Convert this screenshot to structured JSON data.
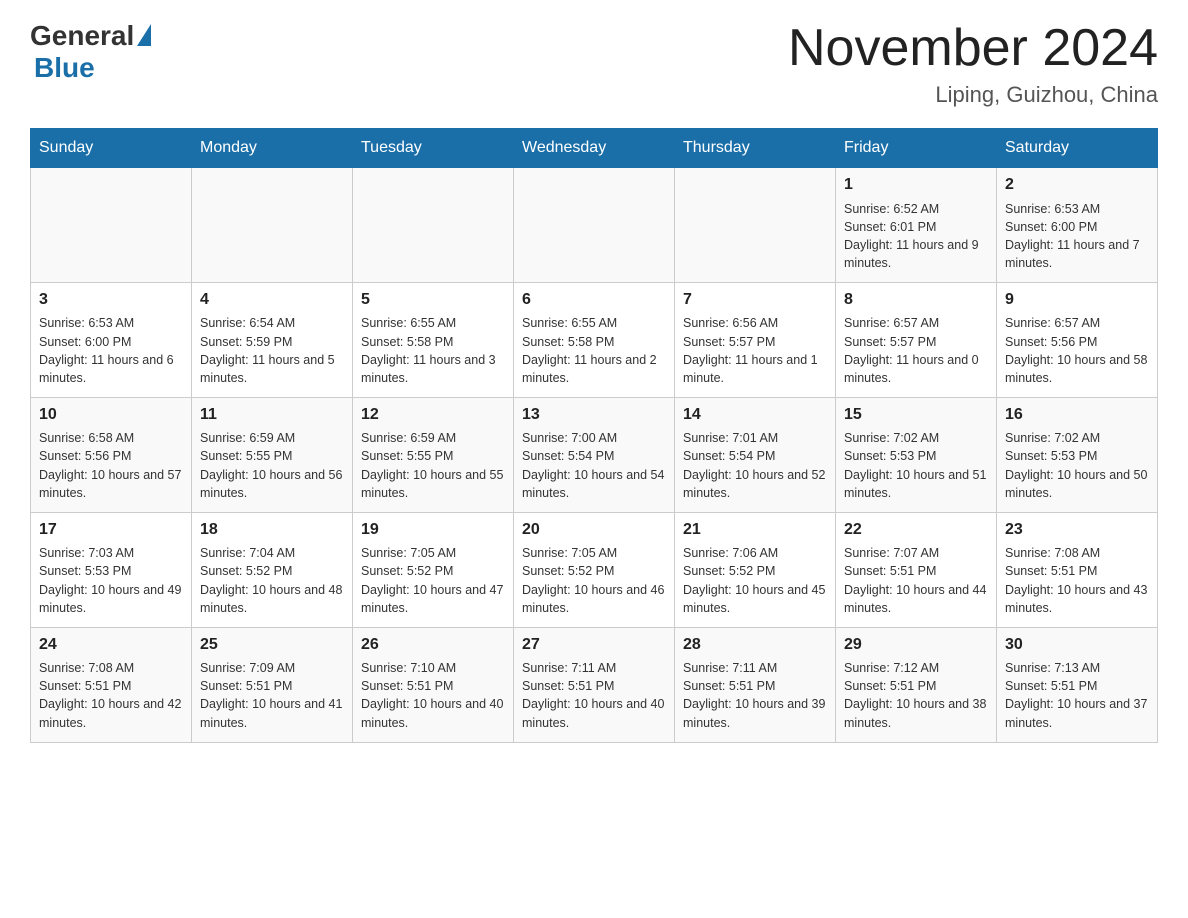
{
  "header": {
    "logo_general": "General",
    "logo_blue": "Blue",
    "month_title": "November 2024",
    "location": "Liping, Guizhou, China"
  },
  "days_of_week": [
    "Sunday",
    "Monday",
    "Tuesday",
    "Wednesday",
    "Thursday",
    "Friday",
    "Saturday"
  ],
  "weeks": [
    {
      "days": [
        {
          "num": "",
          "info": ""
        },
        {
          "num": "",
          "info": ""
        },
        {
          "num": "",
          "info": ""
        },
        {
          "num": "",
          "info": ""
        },
        {
          "num": "",
          "info": ""
        },
        {
          "num": "1",
          "info": "Sunrise: 6:52 AM\nSunset: 6:01 PM\nDaylight: 11 hours and 9 minutes."
        },
        {
          "num": "2",
          "info": "Sunrise: 6:53 AM\nSunset: 6:00 PM\nDaylight: 11 hours and 7 minutes."
        }
      ]
    },
    {
      "days": [
        {
          "num": "3",
          "info": "Sunrise: 6:53 AM\nSunset: 6:00 PM\nDaylight: 11 hours and 6 minutes."
        },
        {
          "num": "4",
          "info": "Sunrise: 6:54 AM\nSunset: 5:59 PM\nDaylight: 11 hours and 5 minutes."
        },
        {
          "num": "5",
          "info": "Sunrise: 6:55 AM\nSunset: 5:58 PM\nDaylight: 11 hours and 3 minutes."
        },
        {
          "num": "6",
          "info": "Sunrise: 6:55 AM\nSunset: 5:58 PM\nDaylight: 11 hours and 2 minutes."
        },
        {
          "num": "7",
          "info": "Sunrise: 6:56 AM\nSunset: 5:57 PM\nDaylight: 11 hours and 1 minute."
        },
        {
          "num": "8",
          "info": "Sunrise: 6:57 AM\nSunset: 5:57 PM\nDaylight: 11 hours and 0 minutes."
        },
        {
          "num": "9",
          "info": "Sunrise: 6:57 AM\nSunset: 5:56 PM\nDaylight: 10 hours and 58 minutes."
        }
      ]
    },
    {
      "days": [
        {
          "num": "10",
          "info": "Sunrise: 6:58 AM\nSunset: 5:56 PM\nDaylight: 10 hours and 57 minutes."
        },
        {
          "num": "11",
          "info": "Sunrise: 6:59 AM\nSunset: 5:55 PM\nDaylight: 10 hours and 56 minutes."
        },
        {
          "num": "12",
          "info": "Sunrise: 6:59 AM\nSunset: 5:55 PM\nDaylight: 10 hours and 55 minutes."
        },
        {
          "num": "13",
          "info": "Sunrise: 7:00 AM\nSunset: 5:54 PM\nDaylight: 10 hours and 54 minutes."
        },
        {
          "num": "14",
          "info": "Sunrise: 7:01 AM\nSunset: 5:54 PM\nDaylight: 10 hours and 52 minutes."
        },
        {
          "num": "15",
          "info": "Sunrise: 7:02 AM\nSunset: 5:53 PM\nDaylight: 10 hours and 51 minutes."
        },
        {
          "num": "16",
          "info": "Sunrise: 7:02 AM\nSunset: 5:53 PM\nDaylight: 10 hours and 50 minutes."
        }
      ]
    },
    {
      "days": [
        {
          "num": "17",
          "info": "Sunrise: 7:03 AM\nSunset: 5:53 PM\nDaylight: 10 hours and 49 minutes."
        },
        {
          "num": "18",
          "info": "Sunrise: 7:04 AM\nSunset: 5:52 PM\nDaylight: 10 hours and 48 minutes."
        },
        {
          "num": "19",
          "info": "Sunrise: 7:05 AM\nSunset: 5:52 PM\nDaylight: 10 hours and 47 minutes."
        },
        {
          "num": "20",
          "info": "Sunrise: 7:05 AM\nSunset: 5:52 PM\nDaylight: 10 hours and 46 minutes."
        },
        {
          "num": "21",
          "info": "Sunrise: 7:06 AM\nSunset: 5:52 PM\nDaylight: 10 hours and 45 minutes."
        },
        {
          "num": "22",
          "info": "Sunrise: 7:07 AM\nSunset: 5:51 PM\nDaylight: 10 hours and 44 minutes."
        },
        {
          "num": "23",
          "info": "Sunrise: 7:08 AM\nSunset: 5:51 PM\nDaylight: 10 hours and 43 minutes."
        }
      ]
    },
    {
      "days": [
        {
          "num": "24",
          "info": "Sunrise: 7:08 AM\nSunset: 5:51 PM\nDaylight: 10 hours and 42 minutes."
        },
        {
          "num": "25",
          "info": "Sunrise: 7:09 AM\nSunset: 5:51 PM\nDaylight: 10 hours and 41 minutes."
        },
        {
          "num": "26",
          "info": "Sunrise: 7:10 AM\nSunset: 5:51 PM\nDaylight: 10 hours and 40 minutes."
        },
        {
          "num": "27",
          "info": "Sunrise: 7:11 AM\nSunset: 5:51 PM\nDaylight: 10 hours and 40 minutes."
        },
        {
          "num": "28",
          "info": "Sunrise: 7:11 AM\nSunset: 5:51 PM\nDaylight: 10 hours and 39 minutes."
        },
        {
          "num": "29",
          "info": "Sunrise: 7:12 AM\nSunset: 5:51 PM\nDaylight: 10 hours and 38 minutes."
        },
        {
          "num": "30",
          "info": "Sunrise: 7:13 AM\nSunset: 5:51 PM\nDaylight: 10 hours and 37 minutes."
        }
      ]
    }
  ]
}
